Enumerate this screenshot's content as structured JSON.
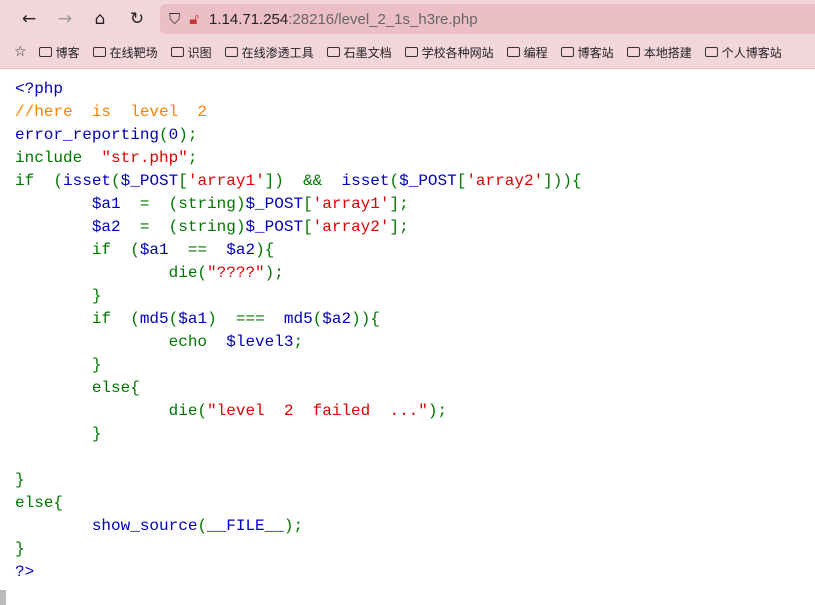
{
  "browser": {
    "url_host": "1.14.71.254",
    "url_rest": ":28216/level_2_1s_h3re.php",
    "bookmarks": [
      "博客",
      "在线靶场",
      "识图",
      "在线渗透工具",
      "石墨文档",
      "学校各种网站",
      "编程",
      "博客站",
      "本地搭建",
      "个人博客站"
    ]
  },
  "colors": {
    "keyword": "#007700",
    "default": "#0000BB",
    "string": "#DD0000",
    "comment": "#FF8000"
  },
  "code_lines": [
    [
      [
        "d",
        "<?php"
      ]
    ],
    [
      [
        "c",
        "//here  is  level  2"
      ]
    ],
    [
      [
        "d",
        "error_reporting"
      ],
      [
        "k",
        "("
      ],
      [
        "d",
        "0"
      ],
      [
        "k",
        ");"
      ]
    ],
    [
      [
        "k",
        "include  "
      ],
      [
        "s",
        "\"str.php\""
      ],
      [
        "k",
        ";"
      ]
    ],
    [
      [
        "k",
        "if  ("
      ],
      [
        "d",
        "isset"
      ],
      [
        "k",
        "("
      ],
      [
        "d",
        "$_POST"
      ],
      [
        "k",
        "["
      ],
      [
        "s",
        "'array1'"
      ],
      [
        "k",
        "])  &&  "
      ],
      [
        "d",
        "isset"
      ],
      [
        "k",
        "("
      ],
      [
        "d",
        "$_POST"
      ],
      [
        "k",
        "["
      ],
      [
        "s",
        "'array2'"
      ],
      [
        "k",
        "])){"
      ]
    ],
    [
      [
        "k",
        "\t"
      ],
      [
        "d",
        "$a1"
      ],
      [
        "k",
        "  =  (string)"
      ],
      [
        "d",
        "$_POST"
      ],
      [
        "k",
        "["
      ],
      [
        "s",
        "'array1'"
      ],
      [
        "k",
        "];"
      ]
    ],
    [
      [
        "k",
        "\t"
      ],
      [
        "d",
        "$a2"
      ],
      [
        "k",
        "  =  (string)"
      ],
      [
        "d",
        "$_POST"
      ],
      [
        "k",
        "["
      ],
      [
        "s",
        "'array2'"
      ],
      [
        "k",
        "];"
      ]
    ],
    [
      [
        "k",
        "\tif  ("
      ],
      [
        "d",
        "$a1"
      ],
      [
        "k",
        "  ==  "
      ],
      [
        "d",
        "$a2"
      ],
      [
        "k",
        "){"
      ]
    ],
    [
      [
        "k",
        "\t\tdie("
      ],
      [
        "s",
        "\"????\""
      ],
      [
        "k",
        ");"
      ]
    ],
    [
      [
        "k",
        "\t}"
      ]
    ],
    [
      [
        "k",
        "\tif  ("
      ],
      [
        "d",
        "md5"
      ],
      [
        "k",
        "("
      ],
      [
        "d",
        "$a1"
      ],
      [
        "k",
        ")  ===  "
      ],
      [
        "d",
        "md5"
      ],
      [
        "k",
        "("
      ],
      [
        "d",
        "$a2"
      ],
      [
        "k",
        ")){"
      ]
    ],
    [
      [
        "k",
        "\t\techo  "
      ],
      [
        "d",
        "$level3"
      ],
      [
        "k",
        ";"
      ]
    ],
    [
      [
        "k",
        "\t}"
      ]
    ],
    [
      [
        "k",
        "\telse{"
      ]
    ],
    [
      [
        "k",
        "\t\tdie("
      ],
      [
        "s",
        "\"level  2  failed  ...\""
      ],
      [
        "k",
        ");"
      ]
    ],
    [
      [
        "k",
        "\t}"
      ]
    ],
    [
      [
        "k",
        " "
      ]
    ],
    [
      [
        "k",
        "}"
      ]
    ],
    [
      [
        "k",
        "else{"
      ]
    ],
    [
      [
        "k",
        "\t"
      ],
      [
        "d",
        "show_source"
      ],
      [
        "k",
        "("
      ],
      [
        "d",
        "__FILE__"
      ],
      [
        "k",
        ");"
      ]
    ],
    [
      [
        "k",
        "}"
      ]
    ],
    [
      [
        "d",
        "?>"
      ]
    ]
  ]
}
